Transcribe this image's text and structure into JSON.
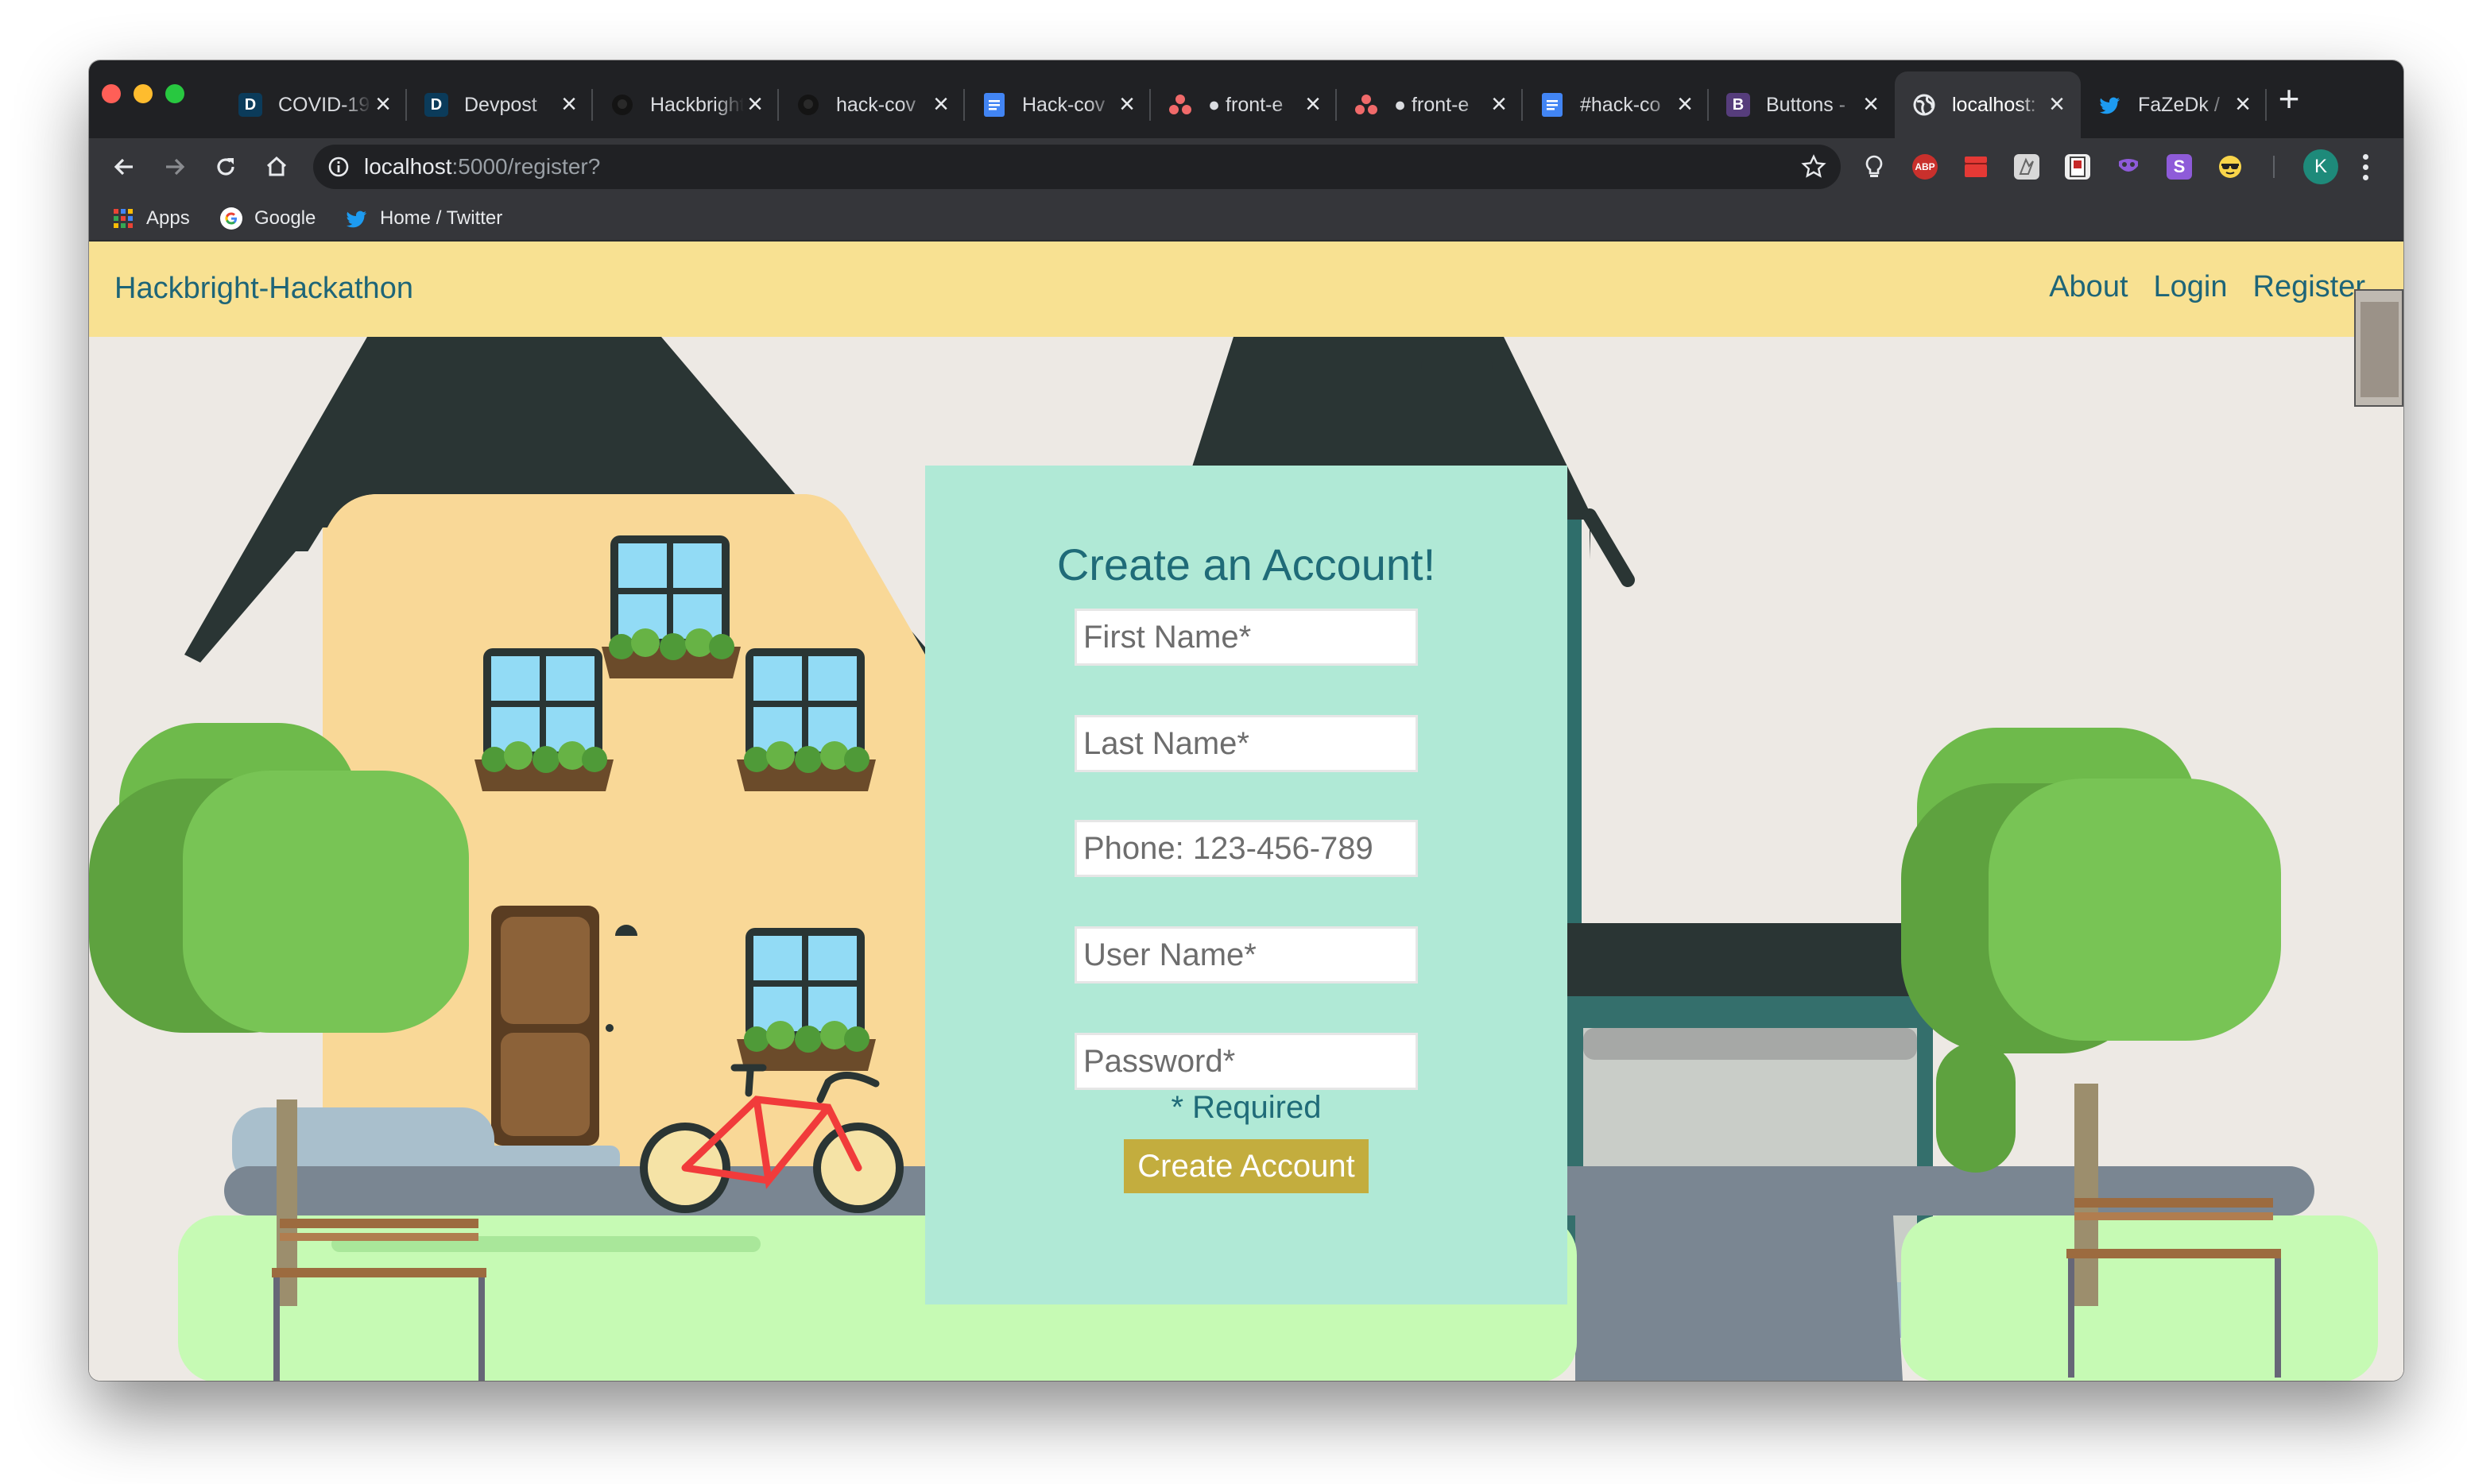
{
  "browser": {
    "tabs": [
      {
        "title": "COVID-19",
        "icon": "devpost-icon"
      },
      {
        "title": "Devpost",
        "icon": "devpost-icon"
      },
      {
        "title": "Hackbright",
        "icon": "github-icon"
      },
      {
        "title": "hack-cov",
        "icon": "github-icon"
      },
      {
        "title": "Hack-cov",
        "icon": "google-docs-icon"
      },
      {
        "title": "● front-e",
        "icon": "asana-icon"
      },
      {
        "title": "● front-e",
        "icon": "asana-icon"
      },
      {
        "title": "#hack-co",
        "icon": "google-docs-icon"
      },
      {
        "title": "Buttons -",
        "icon": "bootstrap-icon"
      },
      {
        "title": "localhost:",
        "icon": "globe-icon",
        "active": true
      },
      {
        "title": "FaZeDk /",
        "icon": "twitter-icon"
      }
    ],
    "address": {
      "host": "localhost",
      "path": ":5000/register?"
    },
    "bookmarks": [
      {
        "label": "Apps",
        "icon": "apps-grid-icon"
      },
      {
        "label": "Google",
        "icon": "google-icon"
      },
      {
        "label": "Home / Twitter",
        "icon": "twitter-icon"
      }
    ],
    "extensions": [
      "lightbulb-icon",
      "adblock-plus-icon",
      "stack-icon",
      "kami-icon",
      "book-icon",
      "mask-icon",
      "stylus-icon",
      "sunglasses-icon"
    ],
    "extension_labels": {
      "abp": "ABP",
      "stylus": "S"
    },
    "profile_initial": "K"
  },
  "site": {
    "brand": "Hackbright-Hackathon",
    "nav": {
      "about": "About",
      "login": "Login",
      "register": "Register"
    }
  },
  "form": {
    "title": "Create an Account!",
    "fields": {
      "first_name": {
        "placeholder": "First Name*",
        "value": ""
      },
      "last_name": {
        "placeholder": "Last Name*",
        "value": ""
      },
      "phone": {
        "placeholder": "Phone: 123-456-789",
        "value": ""
      },
      "username": {
        "placeholder": "User Name*",
        "value": ""
      },
      "password": {
        "placeholder": "Password*",
        "value": ""
      }
    },
    "required_note": "* Required",
    "submit_label": "Create Account"
  },
  "colors": {
    "navbar_bg": "#f8e192",
    "card_bg": "#b0e9d6",
    "accent_text": "#1f6b78",
    "button_bg": "#c3ad3e",
    "page_bg": "#ede9e4"
  }
}
